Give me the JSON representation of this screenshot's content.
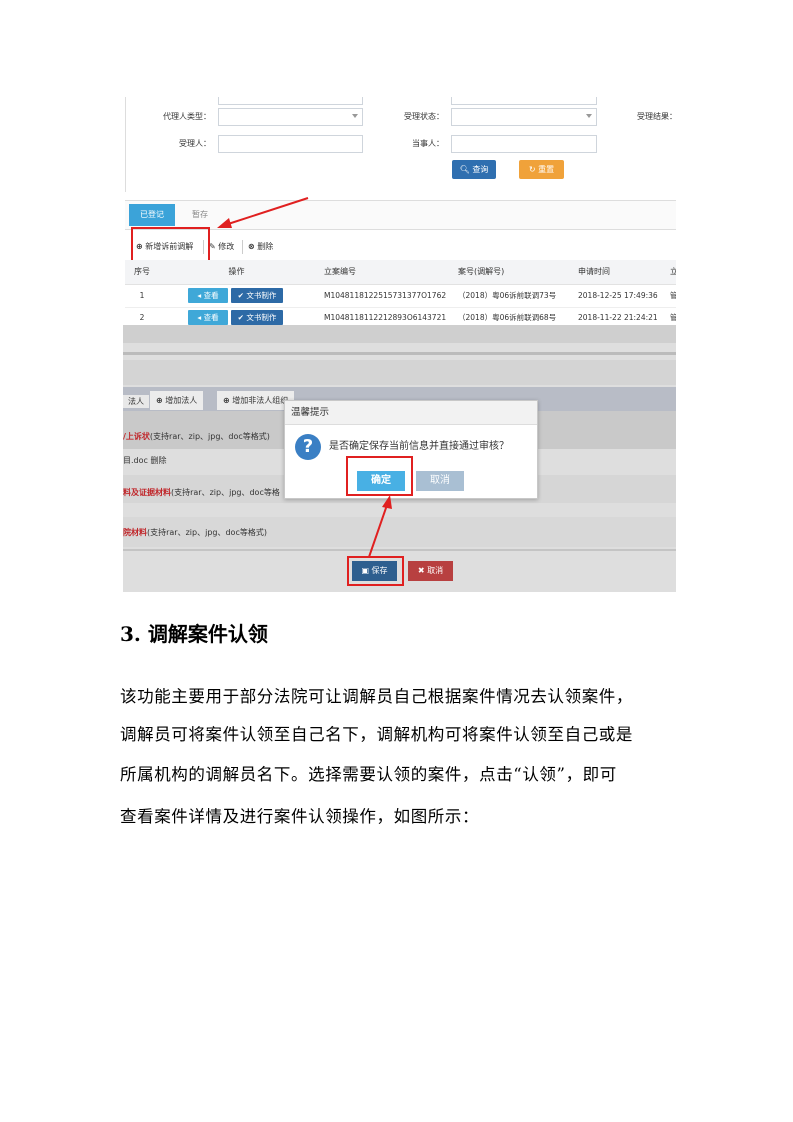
{
  "screenshot1": {
    "filters": {
      "agent_type_label": "代理人类型：",
      "accept_status_label": "受理状态：",
      "accept_result_label": "受理结果：",
      "acceptor_label": "受理人：",
      "party_label": "当事人："
    },
    "query_button": "查询",
    "reset_button": "重置",
    "tabs": [
      "已登记",
      "暂存"
    ],
    "toolbar": {
      "add": "新增诉前调解",
      "edit": "修改",
      "delete": "删除"
    },
    "table": {
      "headers": [
        "序号",
        "操作",
        "立案编号",
        "案号(调解号)",
        "申请时间",
        "立"
      ],
      "rows": [
        {
          "index": "1",
          "view": "查看",
          "doc": "文书制作",
          "case_id": "M1048118122515731377O1762",
          "case_no": "（2018）粤06诉前联调73号",
          "time": "2018-12-25 17:49:36",
          "extra": "管"
        },
        {
          "index": "2",
          "view": "查看",
          "doc": "文书制作",
          "case_id": "M1048118112212893O6143721",
          "case_no": "（2018）粤06诉前联调68号",
          "time": "2018-11-22 21:24:21",
          "extra": "管"
        }
      ]
    }
  },
  "screenshot2": {
    "add_buttons": [
      "法人",
      "增加法人",
      "增加非法人组织"
    ],
    "section1": "/上诉状",
    "section1_hint": "(支持rar、zip、jpg、doc等格式)",
    "file_name": "目.doc",
    "file_delete": "删除",
    "section2": "料及证据材料",
    "section2_hint": "(支持rar、zip、jpg、doc等格",
    "section3": "院材料",
    "section3_hint": "(支持rar、zip、jpg、doc等格式)",
    "dialog": {
      "title": "温馨提示",
      "message": "是否确定保存当前信息并直接通过审核？",
      "ok": "确定",
      "cancel": "取消"
    },
    "save_button": "保存",
    "cancel_button": "取消"
  },
  "doc": {
    "heading": "3. 调解案件认领",
    "lines": [
      "该功能主要用于部分法院可让调解员自己根据案件情况去认领案件，",
      "调解员可将案件认领至自己名下，调解机构可将案件认领至自己或是",
      "所属机构的调解员名下。选择需要认领的案件，点击“认领”，即可",
      "查看案件详情及进行案件认领操作，如图所示："
    ]
  },
  "colors": {
    "annotation_red": "#e02020",
    "primary_blue": "#2f6fb0",
    "tab_blue": "#3ba3d9"
  }
}
